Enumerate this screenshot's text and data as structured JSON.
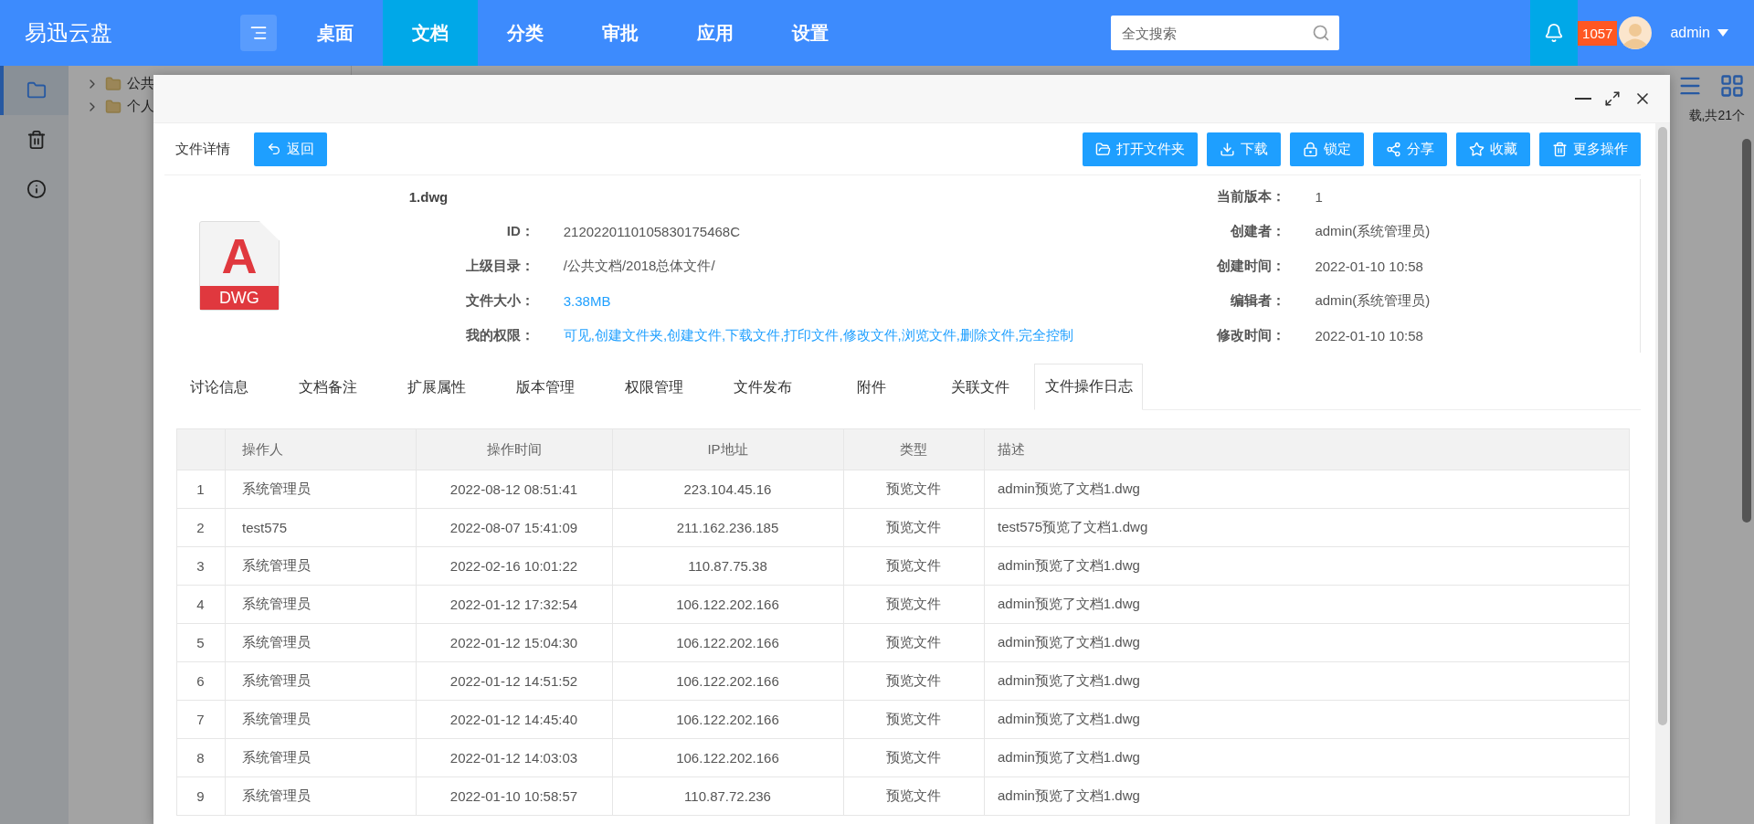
{
  "app": {
    "logo": "易迅云盘"
  },
  "nav": [
    {
      "label": "桌面",
      "selected": false
    },
    {
      "label": "文档",
      "selected": true
    },
    {
      "label": "分类",
      "selected": false
    },
    {
      "label": "审批",
      "selected": false
    },
    {
      "label": "应用",
      "selected": false
    },
    {
      "label": "设置",
      "selected": false
    }
  ],
  "search": {
    "placeholder": "全文搜索"
  },
  "notifications": {
    "count": "1057"
  },
  "user": {
    "name": "admin"
  },
  "sidebar": [
    {
      "kind": "folder",
      "selected": true
    },
    {
      "kind": "trash",
      "selected": false
    },
    {
      "kind": "info",
      "selected": false
    }
  ],
  "background": {
    "tree": [
      {
        "label": "公共"
      },
      {
        "label": "个人"
      }
    ],
    "summary": "载,共21个"
  },
  "modal": {
    "section_title": "文件详情",
    "back_button": "返回",
    "actions": [
      {
        "kind": "folder",
        "label": "打开文件夹"
      },
      {
        "kind": "download",
        "label": "下载"
      },
      {
        "kind": "lock",
        "label": "锁定"
      },
      {
        "kind": "share",
        "label": "分享"
      },
      {
        "kind": "star",
        "label": "收藏"
      },
      {
        "kind": "trash",
        "label": "更多操作"
      }
    ],
    "file": {
      "name": "1.dwg",
      "icon_letter": "A",
      "type_badge": "DWG"
    },
    "fields_left": [
      {
        "label": "ID：",
        "value": "2120220110105830175468C",
        "kind": "text"
      },
      {
        "label": "上级目录：",
        "value": "/公共文档/2018总体文件/",
        "kind": "text"
      },
      {
        "label": "文件大小：",
        "value": "3.38MB",
        "kind": "link"
      },
      {
        "label": "我的权限：",
        "value": "可见,创建文件夹,创建文件,下载文件,打印文件,修改文件,浏览文件,删除文件,完全控制",
        "kind": "link"
      }
    ],
    "fields_right": [
      {
        "label": "当前版本：",
        "value": "1"
      },
      {
        "label": "创建者：",
        "value": "admin(系统管理员)"
      },
      {
        "label": "创建时间：",
        "value": "2022-01-10 10:58"
      },
      {
        "label": "编辑者：",
        "value": "admin(系统管理员)"
      },
      {
        "label": "修改时间：",
        "value": "2022-01-10 10:58"
      }
    ],
    "tabs": [
      {
        "label": "讨论信息",
        "selected": false
      },
      {
        "label": "文档备注",
        "selected": false
      },
      {
        "label": "扩展属性",
        "selected": false
      },
      {
        "label": "版本管理",
        "selected": false
      },
      {
        "label": "权限管理",
        "selected": false
      },
      {
        "label": "文件发布",
        "selected": false
      },
      {
        "label": "附件",
        "selected": false
      },
      {
        "label": "关联文件",
        "selected": false
      },
      {
        "label": "文件操作日志",
        "selected": true
      }
    ],
    "table": {
      "columns": [
        "",
        "操作人",
        "操作时间",
        "IP地址",
        "类型",
        "描述"
      ],
      "rows": [
        [
          "1",
          "系统管理员",
          "2022-08-12 08:51:41",
          "223.104.45.16",
          "预览文件",
          "admin预览了文档1.dwg"
        ],
        [
          "2",
          "test575",
          "2022-08-07 15:41:09",
          "211.162.236.185",
          "预览文件",
          "test575预览了文档1.dwg"
        ],
        [
          "3",
          "系统管理员",
          "2022-02-16 10:01:22",
          "110.87.75.38",
          "预览文件",
          "admin预览了文档1.dwg"
        ],
        [
          "4",
          "系统管理员",
          "2022-01-12 17:32:54",
          "106.122.202.166",
          "预览文件",
          "admin预览了文档1.dwg"
        ],
        [
          "5",
          "系统管理员",
          "2022-01-12 15:04:30",
          "106.122.202.166",
          "预览文件",
          "admin预览了文档1.dwg"
        ],
        [
          "6",
          "系统管理员",
          "2022-01-12 14:51:52",
          "106.122.202.166",
          "预览文件",
          "admin预览了文档1.dwg"
        ],
        [
          "7",
          "系统管理员",
          "2022-01-12 14:45:40",
          "106.122.202.166",
          "预览文件",
          "admin预览了文档1.dwg"
        ],
        [
          "8",
          "系统管理员",
          "2022-01-12 14:03:03",
          "106.122.202.166",
          "预览文件",
          "admin预览了文档1.dwg"
        ],
        [
          "9",
          "系统管理员",
          "2022-01-10 10:58:57",
          "110.87.72.236",
          "预览文件",
          "admin预览了文档1.dwg"
        ]
      ]
    }
  }
}
